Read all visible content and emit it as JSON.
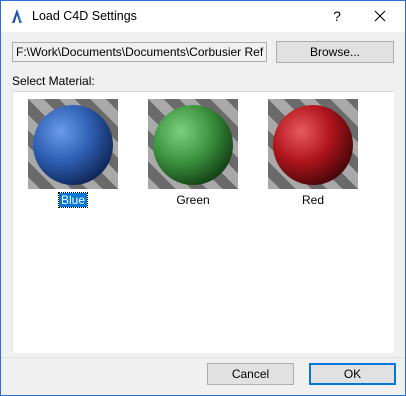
{
  "window": {
    "title": "Load C4D Settings",
    "help_label": "?"
  },
  "path": {
    "value": "F:\\Work\\Documents\\Documents\\Corbusier Ref Gu"
  },
  "browse_label": "Browse...",
  "select_label": "Select Material:",
  "materials": [
    {
      "label": "Blue",
      "color": "#2f5fb3",
      "selected": true
    },
    {
      "label": "Green",
      "color": "#3d9440",
      "selected": false
    },
    {
      "label": "Red",
      "color": "#b0151c",
      "selected": false
    }
  ],
  "buttons": {
    "cancel": "Cancel",
    "ok": "OK"
  },
  "colors": {
    "accent": "#0078d7",
    "window_border": "#2b6fd6"
  }
}
